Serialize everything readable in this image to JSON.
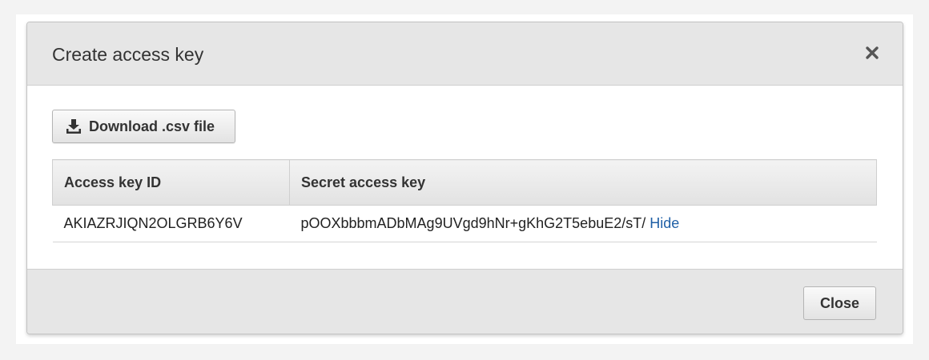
{
  "dialog": {
    "title": "Create access key"
  },
  "download": {
    "label": "Download .csv file",
    "icon": "download-icon"
  },
  "table": {
    "headers": [
      "Access key ID",
      "Secret access key"
    ],
    "rows": [
      {
        "access_key_id": "AKIAZRJIQN2OLGRB6Y6V",
        "secret_access_key": "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",
        "hide_label": "Hide"
      }
    ]
  },
  "footer": {
    "close_label": "Close"
  },
  "colors": {
    "header_bg": "#e6e6e6",
    "link": "#1f5fa6"
  }
}
